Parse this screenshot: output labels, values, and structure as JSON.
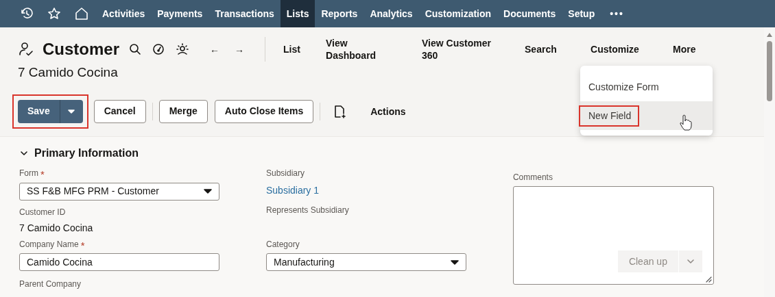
{
  "navbar": {
    "items": [
      {
        "label": "Activities",
        "selected": false
      },
      {
        "label": "Payments",
        "selected": false
      },
      {
        "label": "Transactions",
        "selected": false
      },
      {
        "label": "Lists",
        "selected": true
      },
      {
        "label": "Reports",
        "selected": false
      },
      {
        "label": "Analytics",
        "selected": false
      },
      {
        "label": "Customization",
        "selected": false
      },
      {
        "label": "Documents",
        "selected": false
      },
      {
        "label": "Setup",
        "selected": false
      }
    ],
    "more": "•••"
  },
  "header": {
    "title": "Customer",
    "subtitle": "7 Camido Cocina",
    "back": "←",
    "forward": "→",
    "links": [
      {
        "label": "List"
      },
      {
        "label": "View Dashboard"
      },
      {
        "label": "View Customer 360"
      },
      {
        "label": "Search"
      },
      {
        "label": "Customize"
      },
      {
        "label": "More"
      }
    ]
  },
  "toolbar": {
    "groups": [
      [
        {
          "label": "Save",
          "kind": "split",
          "highlighted": true
        },
        {
          "label": "Cancel",
          "kind": "outline"
        }
      ],
      [
        {
          "label": "Merge",
          "kind": "outline"
        },
        {
          "label": "Auto Close Items",
          "kind": "outline"
        }
      ],
      [
        {
          "label": "Actions",
          "kind": "menu"
        }
      ]
    ]
  },
  "customize_menu": {
    "items": [
      {
        "label": "Customize Form",
        "hovered": false,
        "highlighted": false
      },
      {
        "label": "New Field",
        "hovered": true,
        "highlighted": true
      }
    ]
  },
  "section": {
    "title": "Primary Information",
    "expanded": true,
    "columns": [
      [
        {
          "kind": "select",
          "label": "Form",
          "required_mark": "*",
          "value": "SS F&B MFG PRM - Customer"
        },
        {
          "kind": "text",
          "label": "Customer ID",
          "value": "7 Camido Cocina"
        },
        {
          "kind": "input",
          "label": "Company Name",
          "required_mark": "*",
          "value": "Camido Cocina"
        },
        {
          "kind": "label",
          "label": "Parent Company"
        }
      ],
      [
        {
          "kind": "link",
          "label": "Subsidiary",
          "value": "Subsidiary 1"
        },
        {
          "kind": "label",
          "label": "Represents Subsidiary"
        },
        {
          "kind": "select",
          "label": "Category",
          "value": "Manufacturing"
        }
      ],
      [
        {
          "kind": "textarea",
          "label": "Comments",
          "button": "Clean up"
        }
      ]
    ]
  }
}
